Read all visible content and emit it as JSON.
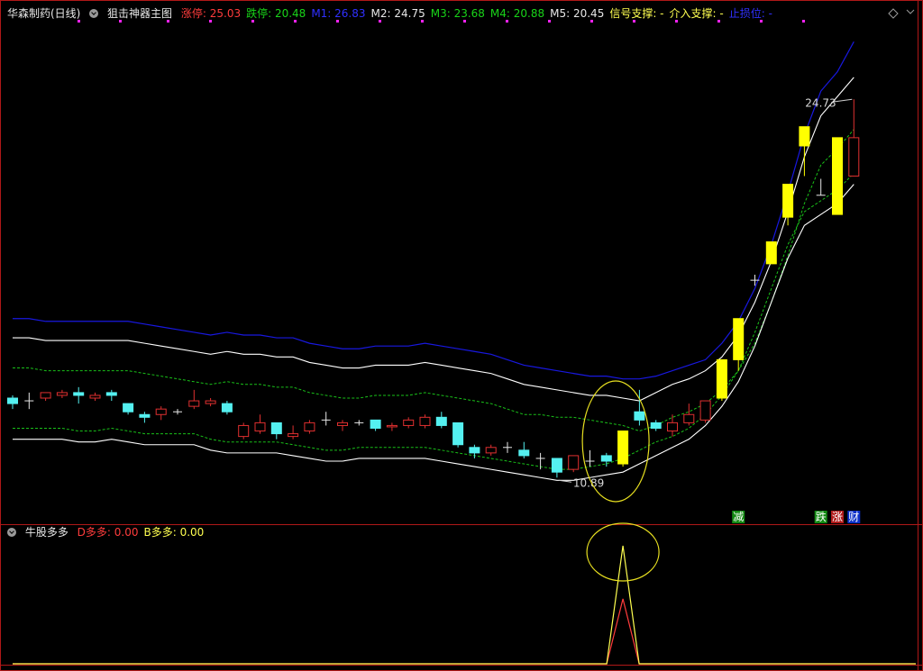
{
  "colors": {
    "up": "#e03030",
    "down": "#54f0f0",
    "limit_up": "#ffff00",
    "border": "#b01818",
    "ma_blue": "#1818e0",
    "band": "#ffffff",
    "dash": "#19c019",
    "red": "#ff3c3c",
    "green": "#19d419",
    "blue": "#3030ff",
    "yellow": "#ffff50",
    "magenta": "#ff22ff",
    "ellipse": "#e8e020"
  },
  "main_header": {
    "stock": "华森制药(日线)",
    "menu_icon": "chevron-down-icon",
    "indicator": "狙击神器主图",
    "items": [
      {
        "label": "涨停",
        "value": "25.03",
        "color": "red"
      },
      {
        "label": "跌停",
        "value": "20.48",
        "color": "green"
      },
      {
        "label": "M1",
        "value": "26.83",
        "color": "blue"
      },
      {
        "label": "M2",
        "value": "24.75",
        "color": "white"
      },
      {
        "label": "M3",
        "value": "23.68",
        "color": "green"
      },
      {
        "label": "M4",
        "value": "20.88",
        "color": "green"
      },
      {
        "label": "M5",
        "value": "20.45",
        "color": "white"
      },
      {
        "label": "信号支撑",
        "value": "-",
        "color": "yellow"
      },
      {
        "label": "介入支撑",
        "value": "-",
        "color": "yellow"
      },
      {
        "label": "止损位",
        "value": "-",
        "color": "blue"
      }
    ]
  },
  "sub_header": {
    "menu_icon": "chevron-down-icon",
    "indicator": "牛股多多",
    "items": [
      {
        "label": "D多多",
        "value": "0.00",
        "color": "red"
      },
      {
        "label": "B多多",
        "value": "0.00",
        "color": "yellow"
      }
    ]
  },
  "chart_data": {
    "type": "candlestick",
    "high_label": "24.73",
    "low_label": "10.89",
    "y_range": [
      9.2,
      27.6
    ],
    "candles": [
      {
        "o": 13.6,
        "c": 13.8,
        "h": 13.9,
        "l": 13.4,
        "k": "down"
      },
      {
        "o": 13.7,
        "c": 13.7,
        "h": 14.0,
        "l": 13.4,
        "k": "doji"
      },
      {
        "o": 13.8,
        "c": 14.0,
        "h": 14.0,
        "l": 13.7,
        "k": "up"
      },
      {
        "o": 13.9,
        "c": 14.0,
        "h": 14.1,
        "l": 13.8,
        "k": "up"
      },
      {
        "o": 14.0,
        "c": 13.9,
        "h": 14.2,
        "l": 13.6,
        "k": "down"
      },
      {
        "o": 13.8,
        "c": 13.9,
        "h": 14.0,
        "l": 13.7,
        "k": "up"
      },
      {
        "o": 14.0,
        "c": 13.9,
        "h": 14.1,
        "l": 13.7,
        "k": "down"
      },
      {
        "o": 13.6,
        "c": 13.3,
        "h": 13.6,
        "l": 13.2,
        "k": "down"
      },
      {
        "o": 13.2,
        "c": 13.1,
        "h": 13.3,
        "l": 12.9,
        "k": "down"
      },
      {
        "o": 13.2,
        "c": 13.4,
        "h": 13.5,
        "l": 13.0,
        "k": "up"
      },
      {
        "o": 13.3,
        "c": 13.3,
        "h": 13.4,
        "l": 13.2,
        "k": "doji"
      },
      {
        "o": 13.5,
        "c": 13.7,
        "h": 14.1,
        "l": 13.4,
        "k": "up"
      },
      {
        "o": 13.6,
        "c": 13.7,
        "h": 13.8,
        "l": 13.5,
        "k": "up"
      },
      {
        "o": 13.6,
        "c": 13.3,
        "h": 13.7,
        "l": 13.2,
        "k": "down"
      },
      {
        "o": 12.4,
        "c": 12.8,
        "h": 12.9,
        "l": 12.3,
        "k": "up"
      },
      {
        "o": 12.6,
        "c": 12.9,
        "h": 13.2,
        "l": 12.5,
        "k": "up"
      },
      {
        "o": 12.9,
        "c": 12.5,
        "h": 12.9,
        "l": 12.3,
        "k": "down"
      },
      {
        "o": 12.4,
        "c": 12.5,
        "h": 12.8,
        "l": 12.3,
        "k": "up"
      },
      {
        "o": 12.6,
        "c": 12.9,
        "h": 13.0,
        "l": 12.5,
        "k": "up"
      },
      {
        "o": 13.0,
        "c": 13.0,
        "h": 13.3,
        "l": 12.8,
        "k": "doji"
      },
      {
        "o": 12.8,
        "c": 12.9,
        "h": 13.0,
        "l": 12.6,
        "k": "up"
      },
      {
        "o": 12.9,
        "c": 12.9,
        "h": 13.0,
        "l": 12.8,
        "k": "doji"
      },
      {
        "o": 13.0,
        "c": 12.7,
        "h": 13.0,
        "l": 12.6,
        "k": "down"
      },
      {
        "o": 12.8,
        "c": 12.8,
        "h": 12.9,
        "l": 12.6,
        "k": "up"
      },
      {
        "o": 12.8,
        "c": 13.0,
        "h": 13.1,
        "l": 12.7,
        "k": "up"
      },
      {
        "o": 12.8,
        "c": 13.1,
        "h": 13.2,
        "l": 12.7,
        "k": "up"
      },
      {
        "o": 13.1,
        "c": 12.8,
        "h": 13.3,
        "l": 12.7,
        "k": "down"
      },
      {
        "o": 12.9,
        "c": 12.1,
        "h": 12.9,
        "l": 12.0,
        "k": "down"
      },
      {
        "o": 12.0,
        "c": 11.8,
        "h": 12.1,
        "l": 11.6,
        "k": "down"
      },
      {
        "o": 11.8,
        "c": 12.0,
        "h": 12.1,
        "l": 11.7,
        "k": "up"
      },
      {
        "o": 12.0,
        "c": 12.0,
        "h": 12.2,
        "l": 11.8,
        "k": "doji"
      },
      {
        "o": 11.9,
        "c": 11.7,
        "h": 12.2,
        "l": 11.6,
        "k": "down"
      },
      {
        "o": 11.6,
        "c": 11.6,
        "h": 11.8,
        "l": 11.2,
        "k": "doji"
      },
      {
        "o": 11.6,
        "c": 11.1,
        "h": 11.6,
        "l": 10.9,
        "k": "down"
      },
      {
        "o": 11.2,
        "c": 11.7,
        "h": 11.7,
        "l": 11.1,
        "k": "up"
      },
      {
        "o": 11.5,
        "c": 11.5,
        "h": 11.9,
        "l": 11.3,
        "k": "doji"
      },
      {
        "o": 11.7,
        "c": 11.5,
        "h": 11.8,
        "l": 11.3,
        "k": "down"
      },
      {
        "o": 11.4,
        "c": 12.6,
        "h": 12.6,
        "l": 11.3,
        "k": "limit"
      },
      {
        "o": 13.0,
        "c": 13.3,
        "h": 14.1,
        "l": 12.8,
        "k": "down"
      },
      {
        "o": 12.9,
        "c": 12.7,
        "h": 13.0,
        "l": 12.6,
        "k": "down"
      },
      {
        "o": 12.6,
        "c": 12.9,
        "h": 13.2,
        "l": 12.4,
        "k": "up"
      },
      {
        "o": 12.9,
        "c": 13.2,
        "h": 13.6,
        "l": 12.8,
        "k": "up"
      },
      {
        "o": 13.0,
        "c": 13.7,
        "h": 13.7,
        "l": 12.9,
        "k": "up"
      },
      {
        "o": 13.8,
        "c": 15.2,
        "h": 15.2,
        "l": 13.7,
        "k": "limit"
      },
      {
        "o": 15.2,
        "c": 16.7,
        "h": 16.7,
        "l": 14.8,
        "k": "limit"
      },
      {
        "o": 18.1,
        "c": 18.1,
        "h": 18.3,
        "l": 17.9,
        "k": "doji"
      },
      {
        "o": 18.7,
        "c": 19.5,
        "h": 19.5,
        "l": 18.7,
        "k": "limit"
      },
      {
        "o": 20.4,
        "c": 21.6,
        "h": 21.6,
        "l": 20.1,
        "k": "limit"
      },
      {
        "o": 23.0,
        "c": 23.7,
        "h": 23.7,
        "l": 21.9,
        "k": "limit"
      },
      {
        "o": 21.2,
        "c": 21.2,
        "h": 21.8,
        "l": 21.2,
        "k": "doji"
      },
      {
        "o": 20.5,
        "c": 23.3,
        "h": 23.3,
        "l": 20.5,
        "k": "limit"
      },
      {
        "o": 23.3,
        "c": 21.9,
        "h": 24.7,
        "l": 21.9,
        "k": "up"
      }
    ],
    "lines": {
      "M1": [
        16.7,
        16.7,
        16.6,
        16.6,
        16.6,
        16.6,
        16.6,
        16.6,
        16.5,
        16.4,
        16.3,
        16.2,
        16.1,
        16.2,
        16.1,
        16.1,
        16.0,
        16.0,
        15.8,
        15.7,
        15.6,
        15.6,
        15.7,
        15.7,
        15.7,
        15.8,
        15.7,
        15.6,
        15.5,
        15.4,
        15.2,
        15.0,
        14.9,
        14.8,
        14.7,
        14.6,
        14.6,
        14.5,
        14.5,
        14.6,
        14.8,
        15.0,
        15.2,
        15.8,
        16.6,
        17.8,
        19.4,
        21.3,
        23.4,
        25.0,
        25.7,
        26.8
      ],
      "M2": [
        16.0,
        16.0,
        15.9,
        15.9,
        15.9,
        15.9,
        15.9,
        15.9,
        15.8,
        15.7,
        15.6,
        15.5,
        15.4,
        15.5,
        15.4,
        15.4,
        15.3,
        15.3,
        15.1,
        15.0,
        14.9,
        14.9,
        15.0,
        15.0,
        15.0,
        15.1,
        15.0,
        14.9,
        14.8,
        14.7,
        14.5,
        14.3,
        14.2,
        14.1,
        14.0,
        13.9,
        13.9,
        13.8,
        13.7,
        14.0,
        14.3,
        14.5,
        14.8,
        15.3,
        16.1,
        17.3,
        18.8,
        20.6,
        22.6,
        24.1,
        24.8,
        25.5
      ],
      "M3": [
        14.9,
        14.9,
        14.8,
        14.8,
        14.8,
        14.8,
        14.8,
        14.8,
        14.7,
        14.6,
        14.5,
        14.4,
        14.3,
        14.4,
        14.3,
        14.3,
        14.2,
        14.2,
        14.0,
        13.9,
        13.8,
        13.8,
        13.9,
        13.9,
        13.9,
        14.0,
        13.9,
        13.8,
        13.7,
        13.6,
        13.4,
        13.2,
        13.2,
        13.1,
        13.1,
        13.0,
        12.9,
        12.8,
        12.6,
        12.8,
        13.1,
        13.3,
        13.6,
        14.1,
        14.8,
        15.8,
        17.3,
        19.0,
        20.9,
        22.3,
        22.9,
        23.6
      ],
      "M4": [
        12.7,
        12.7,
        12.7,
        12.7,
        12.6,
        12.6,
        12.7,
        12.6,
        12.5,
        12.5,
        12.5,
        12.5,
        12.3,
        12.2,
        12.2,
        12.2,
        12.2,
        12.1,
        12.0,
        11.9,
        11.9,
        12.0,
        12.0,
        12.0,
        12.0,
        12.0,
        11.9,
        11.8,
        11.7,
        11.6,
        11.5,
        11.4,
        11.3,
        11.2,
        11.2,
        11.3,
        11.4,
        11.6,
        11.9,
        12.2,
        12.4,
        12.7,
        13.2,
        13.9,
        14.8,
        16.2,
        17.8,
        19.4,
        20.6,
        21.0,
        21.4,
        22.0
      ],
      "M5": [
        12.3,
        12.3,
        12.3,
        12.3,
        12.2,
        12.2,
        12.3,
        12.2,
        12.1,
        12.1,
        12.1,
        12.1,
        11.9,
        11.8,
        11.8,
        11.8,
        11.8,
        11.7,
        11.6,
        11.5,
        11.5,
        11.6,
        11.6,
        11.6,
        11.6,
        11.6,
        11.5,
        11.4,
        11.3,
        11.2,
        11.1,
        11.0,
        10.9,
        10.8,
        10.8,
        10.9,
        11.0,
        11.1,
        11.4,
        11.7,
        12.0,
        12.3,
        12.8,
        13.5,
        14.4,
        15.7,
        17.3,
        18.9,
        20.1,
        20.5,
        20.9,
        21.6
      ]
    },
    "markers": [
      {
        "label": "减",
        "candle": 44,
        "bg": "#148a14"
      },
      {
        "label": "跌",
        "candle": 49,
        "bg": "#148a14"
      },
      {
        "label": "涨",
        "candle": 50,
        "bg": "#b01a1a"
      },
      {
        "label": "财",
        "candle": 51,
        "bg": "#0a2fc8"
      }
    ],
    "ellipses": [
      {
        "label": "signal-area-main",
        "candle": 37
      },
      {
        "label": "signal-area-sub",
        "candle": 37
      }
    ],
    "sub_indicator": {
      "series": [
        {
          "name": "D多多",
          "color": "red",
          "peak": 0.55
        },
        {
          "name": "B多多",
          "color": "yellow",
          "peak": 1.0
        }
      ],
      "peak_candle": 37
    }
  }
}
